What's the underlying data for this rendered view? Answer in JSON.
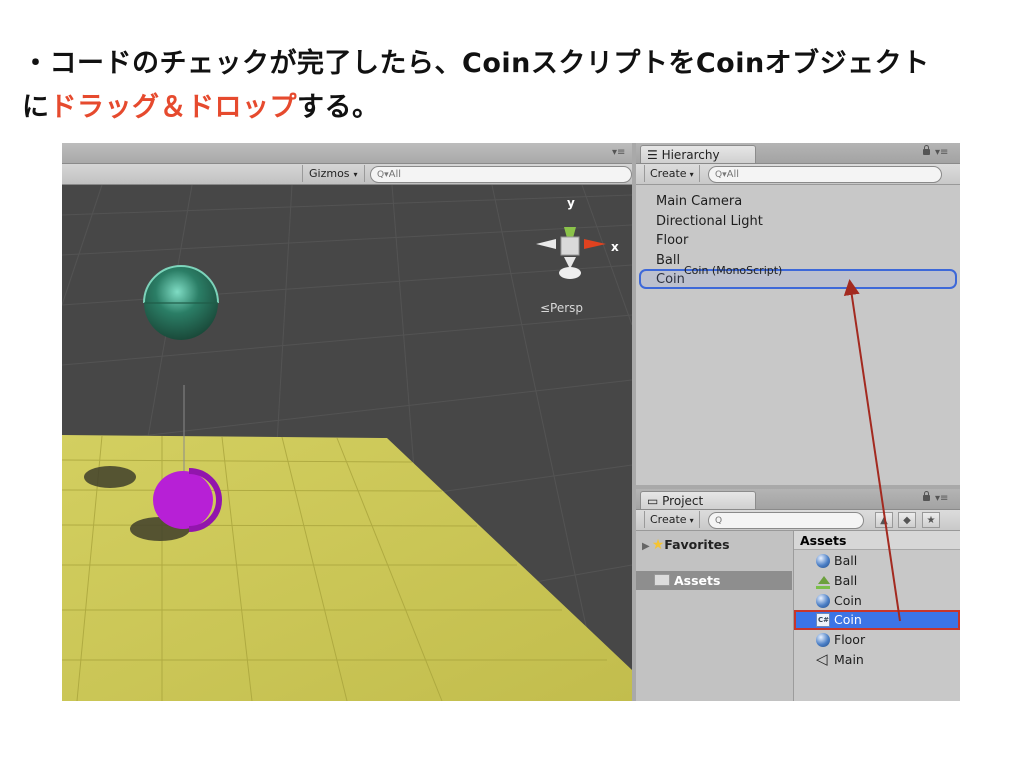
{
  "caption": {
    "line1": "・コードのチェックが完了したら、Coinスクリプトを",
    "line1b": "Coinオブジェクト",
    "line2_prefix": "に",
    "line2_highlight": "ドラッグ＆ドロップ",
    "line2_suffix": "する。"
  },
  "scene": {
    "gizmos_label": "Gizmos",
    "search_placeholder": "All",
    "persp_label": "≤Persp",
    "axis_y": "y",
    "axis_x": "x"
  },
  "hierarchy": {
    "tab_label": "Hierarchy",
    "create_label": "Create",
    "search_placeholder": "All",
    "items": [
      "Main Camera",
      "Directional Light",
      "Floor",
      "Ball",
      "Coin"
    ],
    "drag_label": "Coin (MonoScript)"
  },
  "project": {
    "tab_label": "Project",
    "create_label": "Create",
    "favorites_label": "Favorites",
    "assets_folder_label": "Assets",
    "assets_header": "Assets",
    "assets": [
      {
        "name": "Ball",
        "icon": "material-sphere-icon"
      },
      {
        "name": "Ball",
        "icon": "prefab-icon"
      },
      {
        "name": "Coin",
        "icon": "material-sphere-icon"
      },
      {
        "name": "Coin",
        "icon": "script-icon",
        "selected": true
      },
      {
        "name": "Floor",
        "icon": "material-sphere-icon"
      },
      {
        "name": "Main",
        "icon": "unity-scene-icon"
      }
    ]
  },
  "colors": {
    "highlight_text": "#e64a2e",
    "selection_blue": "#3c74e6",
    "selection_outline": "#c8352a",
    "drop_target": "#3d68d9",
    "arrow": "#a32a20",
    "floor": "#c8c456",
    "coin": "#b720d6",
    "ball": "#2e7e56"
  }
}
